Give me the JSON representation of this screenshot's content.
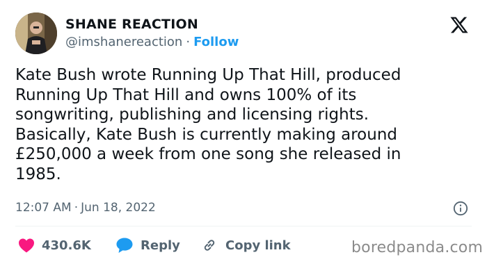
{
  "author": {
    "display_name": "SHANE REACTION",
    "handle": "@imshanereaction",
    "separator": "·",
    "follow_label": "Follow"
  },
  "tweet": {
    "text": "Kate Bush wrote Running Up That Hill, produced\nRunning Up That Hill and owns 100% of its\nsongwriting, publishing and licensing rights.\nBasically, Kate Bush is currently making around\n£250,000 a week from one song she released in\n1985.",
    "time": "12:07 AM",
    "separator": "·",
    "date": "Jun 18, 2022"
  },
  "actions": {
    "like_count": "430.6K",
    "reply_label": "Reply",
    "copy_link_label": "Copy link"
  },
  "watermark": "boredpanda.com",
  "icons": {
    "brand": "x-logo-icon",
    "info": "info-icon",
    "like": "heart-icon",
    "reply": "speech-bubble-icon",
    "copy": "link-icon"
  },
  "colors": {
    "text": "#0f1419",
    "secondary": "#536471",
    "accent": "#1d9bf0",
    "like": "#f91880",
    "divider": "#eff3f4"
  }
}
